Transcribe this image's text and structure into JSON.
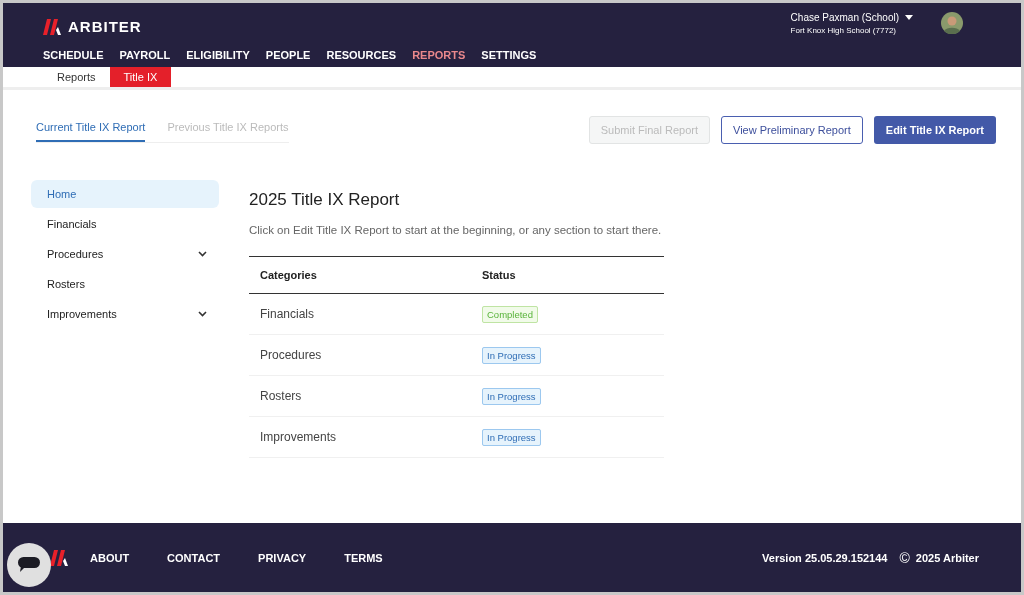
{
  "header": {
    "brand": "ARBITER",
    "user": "Chase Paxman (School)",
    "org": "Fort Knox High School (7772)",
    "nav": [
      {
        "label": "SCHEDULE",
        "selected": false
      },
      {
        "label": "PAYROLL",
        "selected": false
      },
      {
        "label": "ELIGIBILITY",
        "selected": false
      },
      {
        "label": "PEOPLE",
        "selected": false
      },
      {
        "label": "RESOURCES",
        "selected": false
      },
      {
        "label": "REPORTS",
        "selected": true
      },
      {
        "label": "SETTINGS",
        "selected": false
      }
    ]
  },
  "subnav": [
    {
      "label": "Reports",
      "selected": false
    },
    {
      "label": "Title IX",
      "selected": true
    }
  ],
  "tabs": [
    {
      "label": "Current Title IX Report",
      "selected": true
    },
    {
      "label": "Previous Title IX Reports",
      "selected": false
    }
  ],
  "actions": [
    {
      "label": "Submit Final Report",
      "kind": "plain",
      "disabled": true
    },
    {
      "label": "View Preliminary Report",
      "kind": "outline",
      "disabled": false
    },
    {
      "label": "Edit Title IX Report",
      "kind": "primary",
      "disabled": false
    }
  ],
  "sidebar": {
    "items": [
      {
        "label": "Home",
        "selected": true,
        "expandable": false
      },
      {
        "label": "Financials",
        "selected": false,
        "expandable": false
      },
      {
        "label": "Procedures",
        "selected": false,
        "expandable": true
      },
      {
        "label": "Rosters",
        "selected": false,
        "expandable": false
      },
      {
        "label": "Improvements",
        "selected": false,
        "expandable": true
      }
    ]
  },
  "report": {
    "title": "2025 Title IX Report",
    "intro": "Click on Edit Title IX Report to start at the beginning, or any section to start there.",
    "columns": [
      "Categories",
      "Status"
    ],
    "rows": [
      {
        "category": "Financials",
        "status": "Completed",
        "kind": "completed"
      },
      {
        "category": "Procedures",
        "status": "In Progress",
        "kind": "progress"
      },
      {
        "category": "Rosters",
        "status": "In Progress",
        "kind": "progress"
      },
      {
        "category": "Improvements",
        "status": "In Progress",
        "kind": "progress"
      }
    ]
  },
  "footer": {
    "links": [
      "ABOUT",
      "CONTACT",
      "PRIVACY",
      "TERMS"
    ],
    "version": "Version 25.05.29.152144",
    "copyright_symbol": "©",
    "copyright": "2025 Arbiter"
  }
}
